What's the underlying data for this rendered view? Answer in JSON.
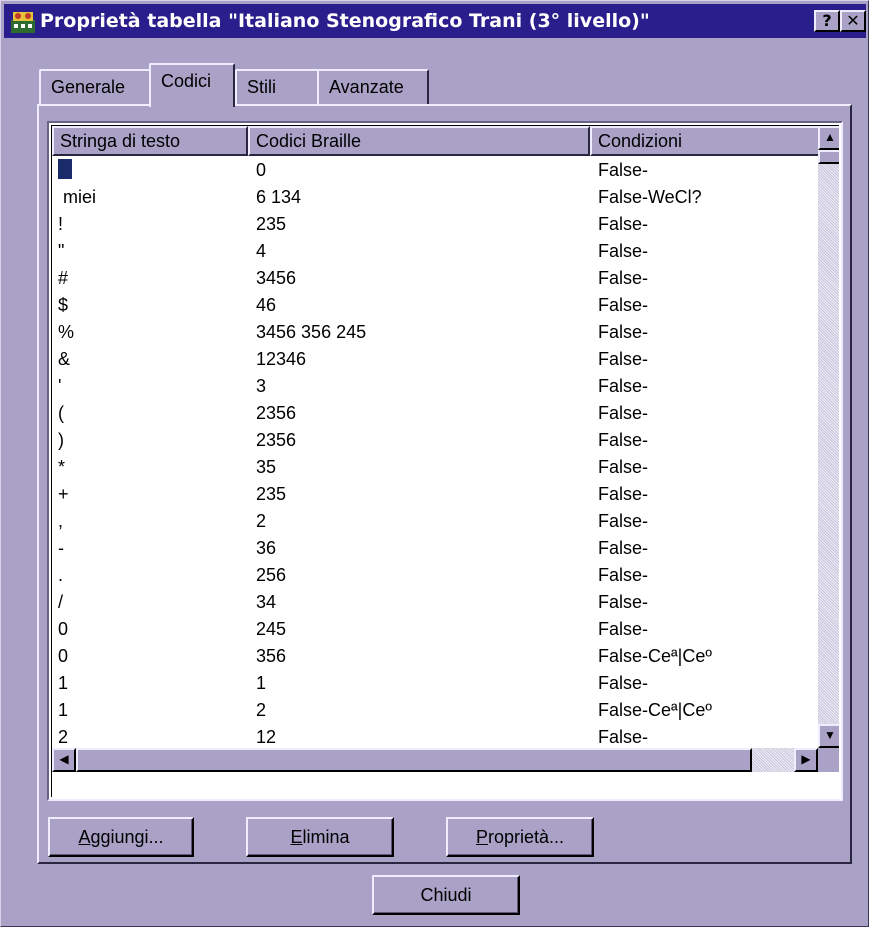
{
  "window": {
    "title": "Proprietà tabella \"Italiano Stenografico Trani (3° livello)\"",
    "help_label": "?",
    "close_label": "✕"
  },
  "tabs": [
    {
      "label": "Generale",
      "active": false
    },
    {
      "label": "Codici",
      "active": true
    },
    {
      "label": "Stili",
      "active": false
    },
    {
      "label": "Avanzate",
      "active": false
    }
  ],
  "table": {
    "columns": [
      "Stringa di testo",
      "Codici Braille",
      "Condizioni"
    ],
    "rows": [
      {
        "text": "",
        "braille": "0",
        "cond": "False-"
      },
      {
        "text": " miei",
        "braille": "6 134",
        "cond": "False-WeCl?"
      },
      {
        "text": "!",
        "braille": "235",
        "cond": "False-"
      },
      {
        "text": "\"",
        "braille": "4",
        "cond": "False-"
      },
      {
        "text": "#",
        "braille": "3456",
        "cond": "False-"
      },
      {
        "text": "$",
        "braille": "46",
        "cond": "False-"
      },
      {
        "text": "%",
        "braille": "3456 356 245",
        "cond": "False-"
      },
      {
        "text": "&",
        "braille": "12346",
        "cond": "False-"
      },
      {
        "text": "'",
        "braille": "3",
        "cond": "False-"
      },
      {
        "text": "(",
        "braille": "2356",
        "cond": "False-"
      },
      {
        "text": ")",
        "braille": "2356",
        "cond": "False-"
      },
      {
        "text": "*",
        "braille": "35",
        "cond": "False-"
      },
      {
        "text": "+",
        "braille": "235",
        "cond": "False-"
      },
      {
        "text": ",",
        "braille": "2",
        "cond": "False-"
      },
      {
        "text": "-",
        "braille": "36",
        "cond": "False-"
      },
      {
        "text": ".",
        "braille": "256",
        "cond": "False-"
      },
      {
        "text": "/",
        "braille": "34",
        "cond": "False-"
      },
      {
        "text": "0",
        "braille": "245",
        "cond": "False-"
      },
      {
        "text": "0",
        "braille": "356",
        "cond": "False-Ceª|Ceº"
      },
      {
        "text": "1",
        "braille": "1",
        "cond": "False-"
      },
      {
        "text": "1",
        "braille": "2",
        "cond": "False-Ceª|Ceº"
      },
      {
        "text": "2",
        "braille": "12",
        "cond": "False-"
      }
    ]
  },
  "buttons": {
    "aggiungi": {
      "hotkey": "A",
      "rest": "ggiungi..."
    },
    "elimina": {
      "hotkey": "E",
      "rest": "limina"
    },
    "proprieta": {
      "hotkey": "P",
      "rest": "roprietà..."
    },
    "chiudi": "Chiudi"
  },
  "scrollbar_icons": {
    "up": "▲",
    "down": "▼",
    "left": "◀",
    "right": "▶"
  }
}
